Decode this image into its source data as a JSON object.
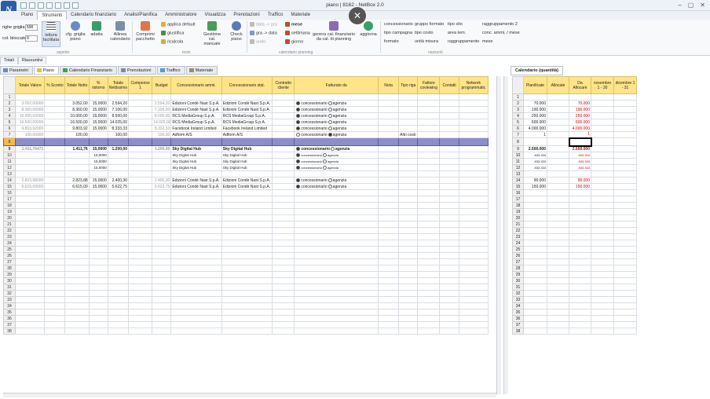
{
  "window": {
    "title": "piano | 8162 - NetBox 2.0",
    "app_letter": "N"
  },
  "tabs": [
    "Piano",
    "Strumenti",
    "Calendario finanziario",
    "Analisi/Pianifica",
    "Amministratore",
    "Visualizza",
    "Prenotazioni",
    "Traffico",
    "Materiale"
  ],
  "ribbon": {
    "righe_label": "righe griglia",
    "righe_value": "500",
    "col_label": "col. bloccate",
    "col_value": "0",
    "buttons": {
      "lettura": "lettura facilitata",
      "cfg": "cfg. griglia piano",
      "adatta": "adatta",
      "allinea": "Allinea calendario",
      "comprimi": "Comprimi pacchetto",
      "gestione": "Gestione cal. manuale",
      "check": "Check piano",
      "genera": "genera cal. finanziario da cal. di planning",
      "aggiorna": "aggiorna"
    },
    "tools_small": [
      "applica default",
      "giustifica",
      "ricalcola"
    ],
    "cal_small": [
      "data -> gra",
      "gra -> data",
      "undo"
    ],
    "cal_period": [
      "mese",
      "settimana",
      "giorno"
    ],
    "summary_cols": [
      [
        "concessionario",
        "tipo campagna",
        "formato"
      ],
      [
        "gruppo formato",
        "tipo costo",
        "unità misura"
      ],
      [
        "tipo sito",
        "area tem.",
        "raggruppamento"
      ],
      [
        "raggruppamento 2",
        "conc. ammi. / mese",
        "mese"
      ]
    ],
    "groups": {
      "aspetto": "aspetto",
      "tools": "tools",
      "calendario": "calendario planning",
      "riassunti": "riassunti"
    }
  },
  "subtabs": [
    "Totali",
    "Riassuntivi"
  ],
  "sheet_tabs": [
    "Parametri",
    "Piano",
    "Calendario Finanziario",
    "Prenotazioni",
    "Traffico",
    "Materiale"
  ],
  "main_grid": {
    "headers": [
      "Totale Valore",
      "% Sconto",
      "Totale Netto",
      "% ristorno",
      "Totale Nettissimo",
      "Compenso 1",
      "Budget",
      "Concessionario ammi.",
      "Concessionario stat.",
      "Contratto cliente",
      "Fatturato da",
      "Nota",
      "Tipo riga",
      "Fattore coviewing",
      "Contatti",
      "Network programmatic"
    ],
    "radio_labels": [
      "concessionario",
      "agenzia"
    ],
    "rows": [
      {
        "n": "1",
        "cells": [
          "",
          "",
          "",
          "",
          "",
          "",
          "",
          "",
          "",
          "",
          "",
          "",
          "",
          "",
          "",
          ""
        ],
        "radio": null
      },
      {
        "n": "2",
        "cells": [
          "3.052,00000",
          "",
          "3.052,00",
          "15,0000",
          "2.594,20",
          "",
          "2.594,20",
          "Edizioni Condè Nast S.p.A.",
          "Edizioni Condè Nast S.p.A.",
          "",
          "",
          "",
          "",
          "",
          "",
          ""
        ],
        "radio": 0
      },
      {
        "n": "3",
        "cells": [
          "8.360,00000",
          "",
          "8.360,00",
          "15,0000",
          "7.106,00",
          "",
          "7.106,00",
          "Edizioni Condè Nast S.p.A.",
          "Edizioni Condè Nast S.p.A.",
          "",
          "",
          "",
          "",
          "",
          "",
          ""
        ],
        "radio": 0
      },
      {
        "n": "4",
        "cells": [
          "10.000,00000",
          "",
          "10.000,00",
          "15,0000",
          "8.500,00",
          "",
          "8.500,00",
          "RCS MediaGroup S.p.A.",
          "RCS MediaGroup S.p.A.",
          "",
          "",
          "",
          "",
          "",
          "",
          ""
        ],
        "radio": 0
      },
      {
        "n": "5",
        "cells": [
          "16.500,00000",
          "",
          "16.500,00",
          "15,0000",
          "14.025,00",
          "",
          "14.025,00",
          "RCS MediaGroup S.p.A.",
          "RCS MediaGroup S.p.A.",
          "",
          "",
          "",
          "",
          "",
          "",
          ""
        ],
        "radio": 0
      },
      {
        "n": "6",
        "cells": [
          "9.803,92000",
          "",
          "9.803,92",
          "15,0000",
          "8.333,33",
          "",
          "8.333,33",
          "Facebook Ireland Limited",
          "Facebook Ireland Limited",
          "",
          "",
          "",
          "",
          "",
          "",
          ""
        ],
        "radio": 0
      },
      {
        "n": "7",
        "cells": [
          "100,00000",
          "",
          "100,00",
          "",
          "100,00",
          "",
          "100,00",
          "Adform A/S",
          "Adform A/S",
          "",
          "",
          "",
          "Altri costi",
          "",
          "",
          ""
        ],
        "radio": 1
      },
      {
        "n": "8",
        "cells": [
          "",
          "",
          "",
          "",
          "",
          "",
          "",
          "",
          "",
          "",
          "",
          "",
          "",
          "",
          "",
          ""
        ],
        "radio": null,
        "selected": true
      },
      {
        "n": "9",
        "cells": [
          "1.411,76471",
          "",
          "1.411,76",
          "15,0000",
          "1.200,00",
          "",
          "1.200,00",
          "Sky Digital Hub",
          "Sky Digital Hub",
          "",
          "",
          "",
          "",
          "",
          "",
          ""
        ],
        "radio": 0,
        "bold": true
      },
      {
        "n": "10",
        "cells": [
          "",
          "",
          "",
          "15,0000",
          "",
          "",
          "",
          "Sky Digital Hub",
          "Sky Digital Hub",
          "",
          "",
          "",
          "",
          "",
          "",
          ""
        ],
        "radio": 0,
        "small": true
      },
      {
        "n": "11",
        "cells": [
          "",
          "",
          "",
          "15,0000",
          "",
          "",
          "",
          "Sky Digital Hub",
          "Sky Digital Hub",
          "",
          "",
          "",
          "",
          "",
          "",
          ""
        ],
        "radio": 0,
        "small": true
      },
      {
        "n": "12",
        "cells": [
          "",
          "",
          "",
          "15,0000",
          "",
          "",
          "",
          "Sky Digital Hub",
          "Sky Digital Hub",
          "",
          "",
          "",
          "",
          "",
          "",
          ""
        ],
        "radio": 0,
        "small": true
      },
      {
        "n": "13",
        "cells": [
          "",
          "",
          "",
          "",
          "",
          "",
          "",
          "",
          "",
          "",
          "",
          "",
          "",
          "",
          "",
          ""
        ],
        "radio": null
      },
      {
        "n": "14",
        "cells": [
          "2.823,88000",
          "",
          "2.823,88",
          "15,0000",
          "2.400,30",
          "",
          "2.400,30",
          "Edizioni Condè Nast S.p.A.",
          "Edizioni Condè Nast S.p.A.",
          "",
          "",
          "",
          "",
          "",
          "",
          ""
        ],
        "radio": 0
      },
      {
        "n": "15",
        "cells": [
          "6.615,00000",
          "",
          "6.615,00",
          "15,0000",
          "5.622,75",
          "",
          "5.622,75",
          "Edizioni Condè Nast S.p.A.",
          "Edizioni Condè Nast S.p.A.",
          "",
          "",
          "",
          "",
          "",
          "",
          ""
        ],
        "radio": 0
      }
    ],
    "empty_row_count": 23,
    "first_empty_row": 16
  },
  "right_panel": {
    "tab": "Calendario (quantità)",
    "headers": [
      "Pianificate",
      "Allocate",
      "Da Allocare",
      "novembre 1 - 30",
      "dicembre 1 - 31"
    ],
    "rows": [
      {
        "n": "1",
        "cells": [
          "",
          "",
          "",
          "",
          ""
        ]
      },
      {
        "n": "2",
        "cells": [
          "70.000",
          "",
          "70.000",
          "",
          ""
        ]
      },
      {
        "n": "3",
        "cells": [
          "190.000",
          "",
          "190.000",
          "",
          ""
        ]
      },
      {
        "n": "4",
        "cells": [
          "250.000",
          "",
          "250.000",
          "",
          ""
        ]
      },
      {
        "n": "5",
        "cells": [
          "600.000",
          "",
          "600.000",
          "",
          ""
        ]
      },
      {
        "n": "6",
        "cells": [
          "4.000.000",
          "",
          "4.000.000",
          "",
          ""
        ]
      },
      {
        "n": "7",
        "cells": [
          "1",
          "",
          "1",
          "",
          ""
        ]
      },
      {
        "n": "8",
        "cells": [
          "",
          "",
          "",
          "",
          ""
        ],
        "selected": true
      },
      {
        "n": "9",
        "cells": [
          "2.500.000",
          "",
          "2.500.000",
          "",
          ""
        ],
        "bold": true
      },
      {
        "n": "10",
        "cells": [
          "833.334",
          "",
          "833.334",
          "",
          ""
        ]
      },
      {
        "n": "11",
        "cells": [
          "833.333",
          "",
          "833.333",
          "",
          ""
        ]
      },
      {
        "n": "12",
        "cells": [
          "833.333",
          "",
          "833.333",
          "",
          ""
        ]
      },
      {
        "n": "13",
        "cells": [
          "",
          "",
          "",
          "",
          ""
        ]
      },
      {
        "n": "14",
        "cells": [
          "90.000",
          "",
          "90.000",
          "",
          ""
        ]
      },
      {
        "n": "15",
        "cells": [
          "150.000",
          "",
          "150.000",
          "",
          ""
        ]
      }
    ],
    "empty_row_count": 23,
    "first_empty_row": 16
  },
  "colors": {
    "header_yellow": "#ffe48a",
    "selected_row": "#8a8fc9",
    "red_values": "#cc0000"
  }
}
